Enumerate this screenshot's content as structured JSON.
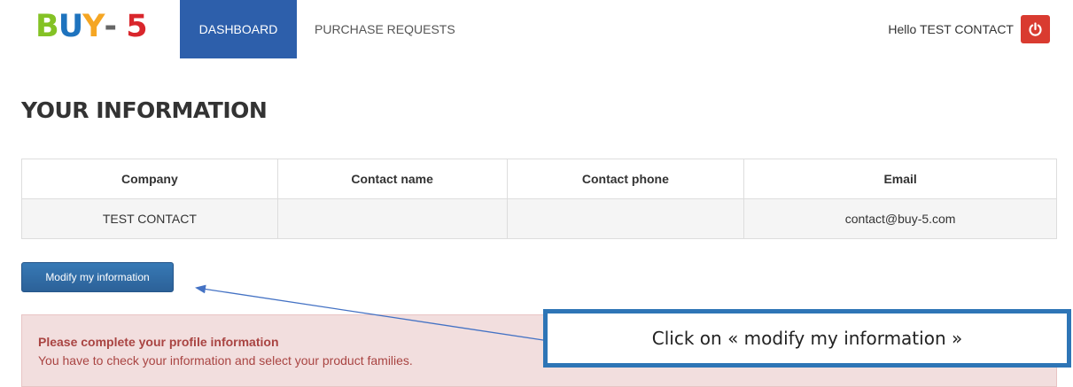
{
  "logo": {
    "letters": [
      "B",
      "U",
      "Y",
      "-",
      " ",
      "5"
    ],
    "colors": [
      "#84c225",
      "#1e73be",
      "#f5a623",
      "#666666",
      "#666666",
      "#d9262c"
    ]
  },
  "nav": {
    "dashboard": "DASHBOARD",
    "purchase_requests": "PURCHASE REQUESTS"
  },
  "user": {
    "greeting": "Hello TEST CONTACT",
    "power_icon": "power-icon"
  },
  "page": {
    "title": "YOUR INFORMATION"
  },
  "table": {
    "headers": [
      "Company",
      "Contact name",
      "Contact phone",
      "Email"
    ],
    "rows": [
      [
        "TEST CONTACT",
        "",
        "",
        "contact@buy-5.com"
      ]
    ]
  },
  "actions": {
    "modify_label": "Modify my information"
  },
  "alert": {
    "title": "Please complete your profile information",
    "text": "You have to check your information and select your product families."
  },
  "callout": {
    "text": "Click on « modify my information »"
  },
  "colors": {
    "primary": "#2d5fab",
    "danger": "#d93b30",
    "alert_bg": "#f2dede",
    "alert_text": "#a94442",
    "callout_border": "#2e75b6"
  }
}
